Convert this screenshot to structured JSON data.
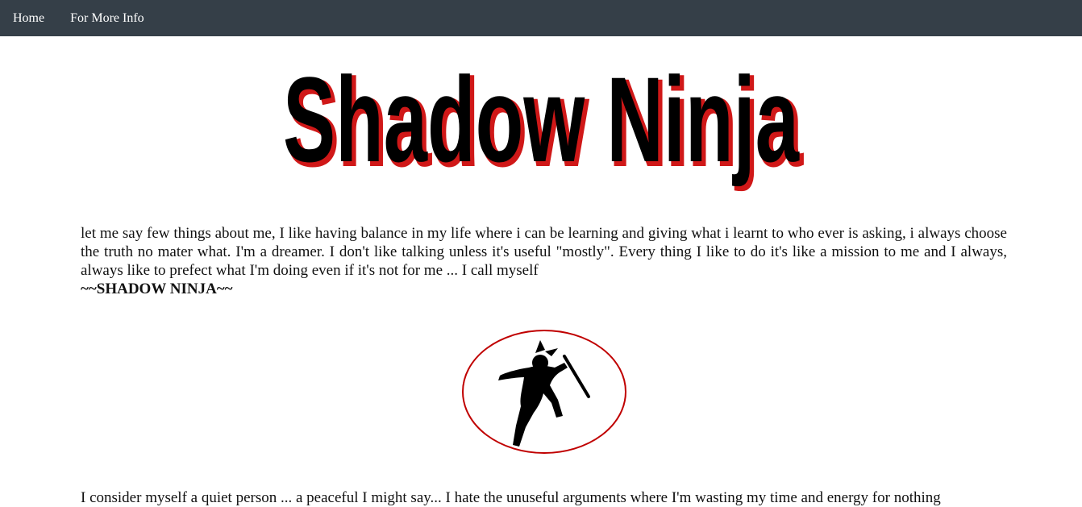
{
  "nav": {
    "home": "Home",
    "more_info": "For More Info"
  },
  "logo": {
    "text": "Shadow Ninja",
    "fill_color": "#000000",
    "outline_color": "#d01818"
  },
  "about": {
    "paragraph1": "let me say few things about me, I like having balance in my life where i can be learning and giving what i learnt to who ever is asking, i always choose the truth no mater what. I'm a dreamer. I don't like talking unless it's useful \"mostly\". Every thing I like to do it's like a mission to me and I always, always like to prefect what I'm doing even if it's not for me ... I call myself",
    "signature": "~~SHADOW NINJA~~",
    "paragraph2": "I consider myself a quiet person ... a peaceful I might say... I hate the unuseful arguments where I'm wasting my time and energy for nothing"
  },
  "colors": {
    "navbar": "#353f48",
    "ellipse_border": "#c00000"
  }
}
